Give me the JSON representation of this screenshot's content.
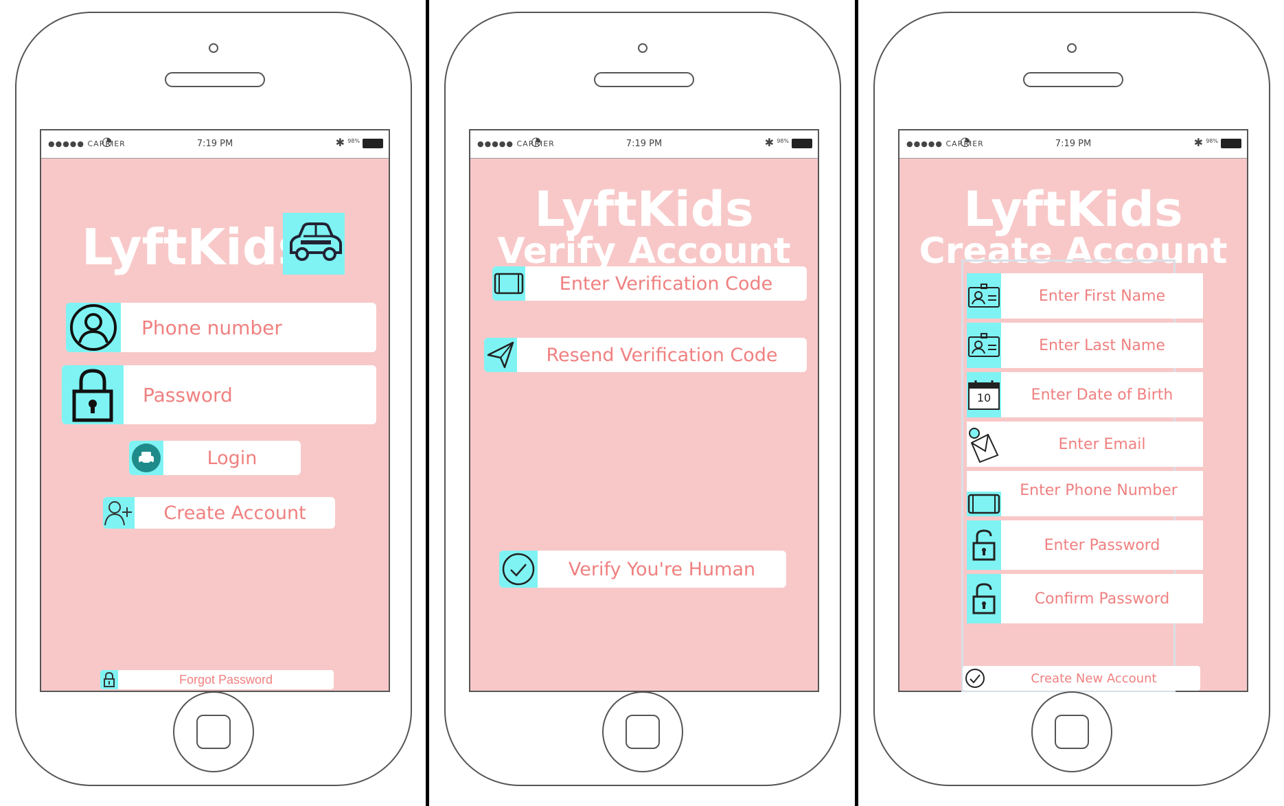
{
  "status_bar": {
    "carrier": "●●●●● CARRIER",
    "time": "7:19 PM",
    "battery_pct": "98%"
  },
  "login": {
    "app_title": "LyftKids",
    "phone_placeholder": "Phone number",
    "password_placeholder": "Password",
    "login_label": "Login",
    "create_account_label": "Create Account",
    "forgot_password_label": "Forgot Password"
  },
  "verify": {
    "app_title": "LyftKids",
    "subtitle": "Verify Account",
    "code_placeholder": "Enter Verification Code",
    "resend_label": "Resend Verification Code",
    "human_label": "Verify You're Human"
  },
  "create": {
    "app_title": "LyftKids",
    "subtitle": "Create Account",
    "first_name": "Enter First Name",
    "last_name": "Enter Last Name",
    "dob": "Enter Date of Birth",
    "calendar_day": "10",
    "email": "Enter Email",
    "phone": "Enter Phone Number",
    "password": "Enter Password",
    "confirm_password": "Confirm Password",
    "submit_label": "Create New Account"
  },
  "colors": {
    "screen_bg": "#f8c8c8",
    "accent": "#7ff3f3",
    "label_text": "#f08080"
  }
}
